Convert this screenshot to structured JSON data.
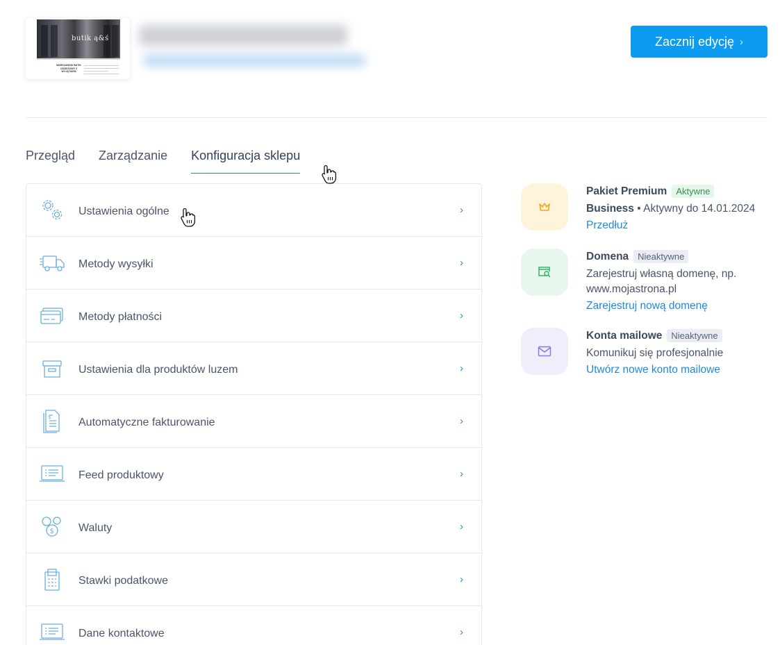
{
  "header": {
    "thumbnail": {
      "logo_text": "butik ą&ś",
      "caption": "WARSZAWSKI BUTIK ODZIEŻOWY Z WYJĄTKIEM"
    },
    "start_button": {
      "label": "Zacznij edycję",
      "chevron": "›"
    }
  },
  "tabs": [
    {
      "label": "Przegląd",
      "active": false
    },
    {
      "label": "Zarządzanie",
      "active": false
    },
    {
      "label": "Konfiguracja sklepu",
      "active": true
    }
  ],
  "settings": [
    {
      "label": "Ustawienia ogólne",
      "icon": "gears-icon"
    },
    {
      "label": "Metody wysyłki",
      "icon": "truck-icon"
    },
    {
      "label": "Metody płatności",
      "icon": "payment-card-icon"
    },
    {
      "label": "Ustawienia dla produktów luzem",
      "icon": "box-icon"
    },
    {
      "label": "Automatyczne fakturowanie",
      "icon": "invoice-icon"
    },
    {
      "label": "Feed produktowy",
      "icon": "feed-list-icon"
    },
    {
      "label": "Waluty",
      "icon": "currency-coins-icon"
    },
    {
      "label": "Stawki podatkowe",
      "icon": "calculator-icon"
    },
    {
      "label": "Dane kontaktowe",
      "icon": "contact-list-icon"
    }
  ],
  "row_arrow": "›",
  "services": {
    "premium": {
      "name": "Pakiet Premium",
      "badge": "Aktywne",
      "plan": "Business",
      "status": " • Aktywny do 14.01.2024",
      "link": "Przedłuż",
      "icon": "crown-icon"
    },
    "domain": {
      "name": "Domena",
      "badge": "Nieaktywne",
      "desc": "Zarejestruj własną domenę, np. www.mojastrona.pl",
      "link": "Zarejestruj nową domenę",
      "icon": "domain-search-icon"
    },
    "mail": {
      "name": "Konta mailowe",
      "badge": "Nieaktywne",
      "desc": "Komunikuj się profesjonalnie",
      "link": "Utwórz nowe konto mailowe",
      "icon": "envelope-icon"
    }
  },
  "colors": {
    "accent": "#0d9bf1",
    "link": "#1f8ad9",
    "premium_bubble": "#fff3dc",
    "domain_bubble": "#e8f7ee",
    "mail_bubble": "#f0eefb"
  }
}
